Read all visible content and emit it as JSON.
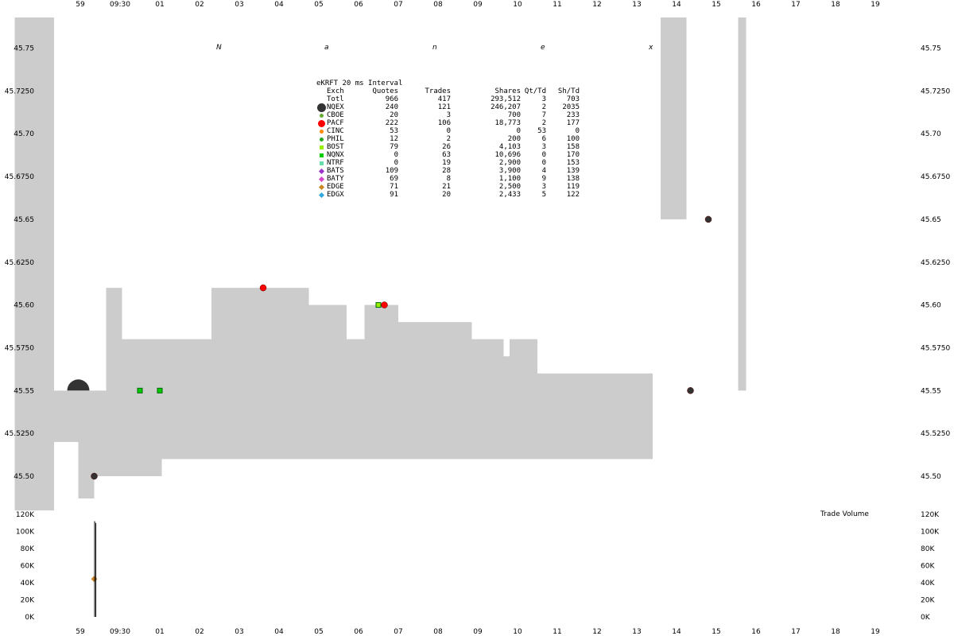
{
  "watermark": [
    "N",
    "a",
    "n",
    "e",
    "x"
  ],
  "chart_data": [
    {
      "type": "area",
      "title": "eKRFT 20 ms Interval",
      "x_ticks_top": [
        "59",
        "09:30",
        "01",
        "02",
        "03",
        "04",
        "05",
        "06",
        "07",
        "08",
        "09",
        "10",
        "11",
        "12",
        "13",
        "14",
        "15",
        "16",
        "17",
        "18",
        "19"
      ],
      "x_ticks_bottom": [
        "59",
        "09:30",
        "01",
        "02",
        "03",
        "04",
        "05",
        "06",
        "07",
        "08",
        "09",
        "10",
        "11",
        "12",
        "13",
        "14",
        "15",
        "16",
        "17",
        "18",
        "19"
      ],
      "y_ticks": [
        "45.75",
        "45.7250",
        "45.70",
        "45.6750",
        "45.65",
        "45.6250",
        "45.60",
        "45.5750",
        "45.55",
        "45.5250",
        "45.50"
      ],
      "ylim": [
        45.48,
        45.79
      ],
      "xlim": [
        -1.7,
        20.3
      ],
      "grid": false,
      "nbbo_spread": [
        {
          "x": [
            -1.65,
            -0.66
          ],
          "low": 45.48,
          "high": 45.79
        },
        {
          "x": [
            -0.66,
            -0.05
          ],
          "low": 45.52,
          "high": 45.55
        },
        {
          "x": [
            -0.05,
            0.35
          ],
          "low": 45.487,
          "high": 45.55
        },
        {
          "x": [
            0.35,
            0.65
          ],
          "low": 45.5,
          "high": 45.55
        },
        {
          "x": [
            0.65,
            1.05
          ],
          "low": 45.5,
          "high": 45.61
        },
        {
          "x": [
            1.05,
            2.05
          ],
          "low": 45.5,
          "high": 45.58
        },
        {
          "x": [
            2.05,
            3.3
          ],
          "low": 45.51,
          "high": 45.58
        },
        {
          "x": [
            3.3,
            5.75
          ],
          "low": 45.51,
          "high": 45.61
        },
        {
          "x": [
            5.75,
            6.7
          ],
          "low": 45.51,
          "high": 45.6
        },
        {
          "x": [
            6.7,
            7.15
          ],
          "low": 45.51,
          "high": 45.58
        },
        {
          "x": [
            7.15,
            8.0
          ],
          "low": 45.51,
          "high": 45.6
        },
        {
          "x": [
            8.0,
            9.85
          ],
          "low": 45.51,
          "high": 45.59
        },
        {
          "x": [
            9.85,
            10.65
          ],
          "low": 45.51,
          "high": 45.58
        },
        {
          "x": [
            10.65,
            10.8
          ],
          "low": 45.51,
          "high": 45.57
        },
        {
          "x": [
            10.8,
            11.5
          ],
          "low": 45.51,
          "high": 45.58
        },
        {
          "x": [
            11.5,
            14.05
          ],
          "low": 45.51,
          "high": 45.56
        },
        {
          "x": [
            14.05,
            14.4
          ],
          "low": 45.51,
          "high": 45.56
        },
        {
          "x": [
            14.6,
            15.05
          ],
          "low": 45.65,
          "high": 45.79
        },
        {
          "x": [
            15.05,
            15.25
          ],
          "low": 45.65,
          "high": 45.79
        },
        {
          "x": [
            16.55,
            16.75
          ],
          "low": 45.55,
          "high": 45.79
        }
      ],
      "trades": [
        {
          "x": -0.05,
          "y": 45.55,
          "exch": "NQEX",
          "size": "large"
        },
        {
          "x": 0.35,
          "y": 45.44,
          "exch": "EDGE"
        },
        {
          "x": 0.35,
          "y": 45.5,
          "exch": "NQEX"
        },
        {
          "x": 1.5,
          "y": 45.55,
          "exch": "NQNX"
        },
        {
          "x": 2.0,
          "y": 45.55,
          "exch": "NQNX"
        },
        {
          "x": 4.6,
          "y": 45.61,
          "exch": "PACF"
        },
        {
          "x": 7.5,
          "y": 45.6,
          "exch": "BOST"
        },
        {
          "x": 7.65,
          "y": 45.6,
          "exch": "PACF"
        },
        {
          "x": 15.35,
          "y": 45.55,
          "exch": "NQEX"
        },
        {
          "x": 15.8,
          "y": 45.65,
          "exch": "NQEX"
        }
      ],
      "volume": {
        "title": "Trade Volume",
        "y_ticks": [
          "120K",
          "100K",
          "80K",
          "60K",
          "40K",
          "20K",
          "0K"
        ],
        "ylim": [
          0,
          120000
        ],
        "bars": [
          {
            "x": 0.35,
            "value": 112000
          },
          {
            "x": 0.38,
            "value": 110000
          }
        ]
      },
      "legend": {
        "headers": {
          "exch": "Exch",
          "quotes": "Quotes",
          "trades": "Trades",
          "shares": "Shares",
          "qt_td": "Qt/Td",
          "sh_td": "Sh/Td"
        },
        "rows": [
          {
            "exch": "Totl",
            "quotes": "966",
            "trades": "417",
            "shares": "293,512",
            "qt_td": "3",
            "sh_td": "703",
            "color": "",
            "marker": "none"
          },
          {
            "exch": "NQEX",
            "quotes": "240",
            "trades": "121",
            "shares": "246,207",
            "qt_td": "2",
            "sh_td": "2035",
            "color": "#333333",
            "marker": "big-circle"
          },
          {
            "exch": "CBOE",
            "quotes": "20",
            "trades": "3",
            "shares": "700",
            "qt_td": "7",
            "sh_td": "233",
            "color": "#66aa33",
            "marker": "small-circle"
          },
          {
            "exch": "PACF",
            "quotes": "222",
            "trades": "106",
            "shares": "18,773",
            "qt_td": "2",
            "sh_td": "177",
            "color": "#ff0000",
            "marker": "circle"
          },
          {
            "exch": "CINC",
            "quotes": "53",
            "trades": "0",
            "shares": "0",
            "qt_td": "53",
            "sh_td": "0",
            "color": "#ff8800",
            "marker": "small-circle"
          },
          {
            "exch": "PHIL",
            "quotes": "12",
            "trades": "2",
            "shares": "200",
            "qt_td": "6",
            "sh_td": "100",
            "color": "#22aa22",
            "marker": "small-circle"
          },
          {
            "exch": "BOST",
            "quotes": "79",
            "trades": "26",
            "shares": "4,103",
            "qt_td": "3",
            "sh_td": "158",
            "color": "#99ee00",
            "marker": "square"
          },
          {
            "exch": "NQNX",
            "quotes": "0",
            "trades": "63",
            "shares": "10,696",
            "qt_td": "0",
            "sh_td": "170",
            "color": "#00cc00",
            "marker": "square"
          },
          {
            "exch": "NTRF",
            "quotes": "0",
            "trades": "19",
            "shares": "2,900",
            "qt_td": "0",
            "sh_td": "153",
            "color": "#66ddaa",
            "marker": "square"
          },
          {
            "exch": "BATS",
            "quotes": "109",
            "trades": "28",
            "shares": "3,900",
            "qt_td": "4",
            "sh_td": "139",
            "color": "#9933cc",
            "marker": "diamond"
          },
          {
            "exch": "BATY",
            "quotes": "69",
            "trades": "8",
            "shares": "1,100",
            "qt_td": "9",
            "sh_td": "138",
            "color": "#dd44cc",
            "marker": "diamond"
          },
          {
            "exch": "EDGE",
            "quotes": "71",
            "trades": "21",
            "shares": "2,500",
            "qt_td": "3",
            "sh_td": "119",
            "color": "#cc8822",
            "marker": "diamond"
          },
          {
            "exch": "EDGX",
            "quotes": "91",
            "trades": "20",
            "shares": "2,433",
            "qt_td": "5",
            "sh_td": "122",
            "color": "#33aadd",
            "marker": "diamond"
          }
        ]
      }
    }
  ]
}
